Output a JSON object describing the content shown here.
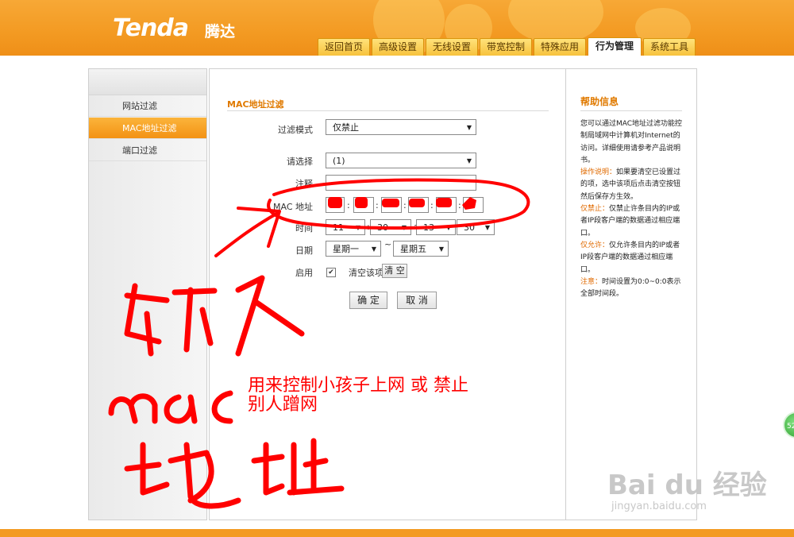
{
  "brand": {
    "logo": "Tenda",
    "logo_cn": "腾达"
  },
  "tabs": [
    {
      "label": "返回首页"
    },
    {
      "label": "高级设置"
    },
    {
      "label": "无线设置"
    },
    {
      "label": "带宽控制"
    },
    {
      "label": "特殊应用"
    },
    {
      "label": "行为管理",
      "active": true
    },
    {
      "label": "系统工具"
    }
  ],
  "sidebar": {
    "items": [
      {
        "label": "网站过滤"
      },
      {
        "label": "MAC地址过滤",
        "active": true
      },
      {
        "label": "端口过滤"
      }
    ]
  },
  "form": {
    "section_title": "MAC地址过滤",
    "filter_mode_label": "过滤模式",
    "filter_mode_value": "仅禁止",
    "select_label": "请选择",
    "select_value": "(1)",
    "note_label": "注释",
    "mac_label": "MAC 地址",
    "time_label": "时间",
    "time_start_hour": "11",
    "time_start_min": "30",
    "time_end_hour": "13",
    "time_end_min": "30",
    "time_separator": "~",
    "date_label": "日期",
    "date_start": "星期一",
    "date_end": "星期五",
    "date_separator": "~",
    "enable_label": "启用",
    "enable_checked": true,
    "clear_label": "清空该项:",
    "clear_button": "清 空",
    "confirm_button": "确 定",
    "cancel_button": "取 消"
  },
  "help": {
    "title": "帮助信息",
    "intro": "您可以通过MAC地址过滤功能控制局域网中计算机对Internet的访问。详细使用请参考产品说明书。",
    "op_label": "操作说明：",
    "op_text": "如果要清空已设置过的项，选中该项后点击清空按钮然后保存方生效。",
    "deny_label": "仅禁止：",
    "deny_text": "仅禁止许条目内的IP或者IP段客户端的数据通过相应端口。",
    "allow_label": "仅允许：",
    "allow_text": "仅允许条目内的IP或者IP段客户端的数据通过相应端口。",
    "note_label": "注意：",
    "note_text": "时间设置为0:0~0:0表示全部时间段。"
  },
  "annotation": {
    "line1": "用来控制小孩子上网 或 禁止",
    "line2": "别人蹭网",
    "handwritten": "输入mac地址"
  },
  "watermark": {
    "logo": "Bai du 经验",
    "url": "jingyan.baidu.com"
  },
  "badge": {
    "value": "52"
  },
  "colors": {
    "accent": "#f39a22",
    "annotation": "#ff0000"
  }
}
